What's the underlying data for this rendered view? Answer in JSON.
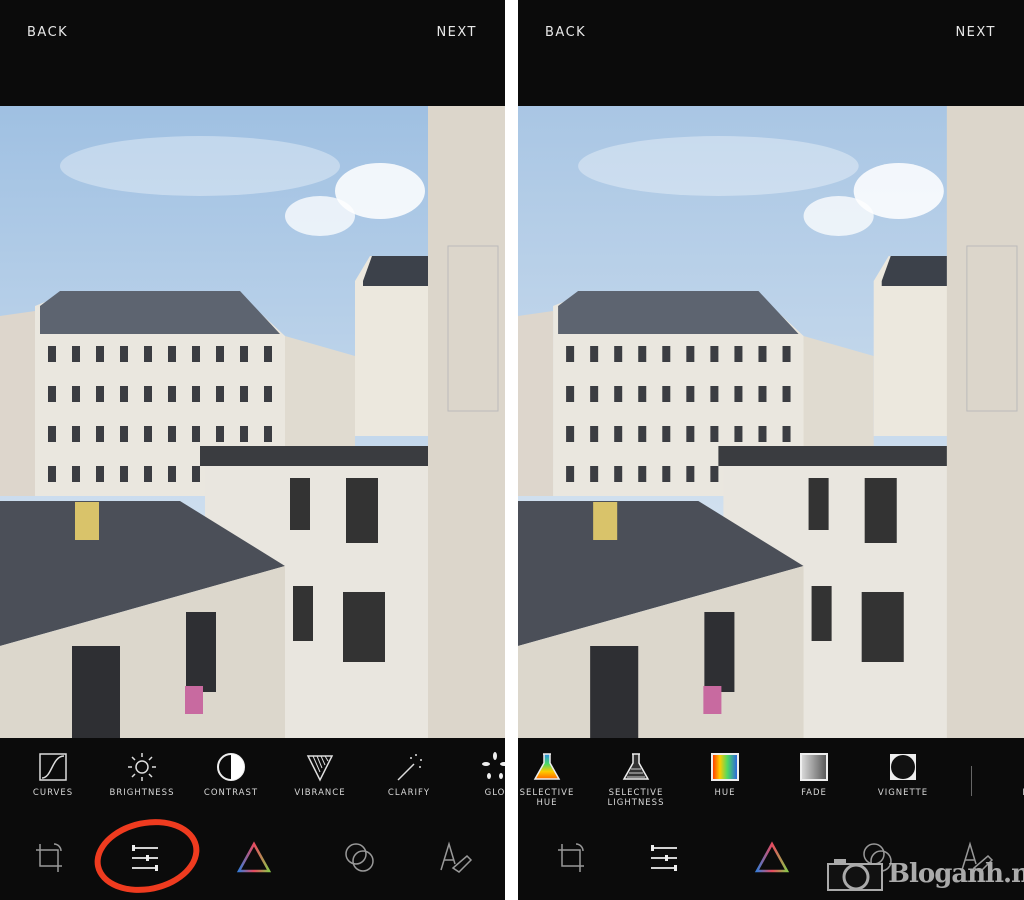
{
  "left": {
    "back_label": "BACK",
    "next_label": "NEXT",
    "tools": [
      {
        "label": "CURVES",
        "icon": "curves-icon"
      },
      {
        "label": "BRIGHTNESS",
        "icon": "sun-icon"
      },
      {
        "label": "CONTRAST",
        "icon": "contrast-icon"
      },
      {
        "label": "VIBRANCE",
        "icon": "vibrance-icon"
      },
      {
        "label": "CLARIFY",
        "icon": "magic-wand-icon"
      },
      {
        "label": "GLO",
        "icon": "glow-icon"
      }
    ],
    "nav": [
      "crop-rotate-icon",
      "sliders-icon",
      "prism-triangle-icon",
      "overlay-circles-icon",
      "text-pen-icon"
    ],
    "active_nav": "sliders-icon",
    "annotation_color": "#ef3b1f"
  },
  "right": {
    "back_label": "BACK",
    "next_label": "NEXT",
    "tools": [
      {
        "label": "SELECTIVE\nHUE",
        "icon": "color-flask-icon"
      },
      {
        "label": "SELECTIVE\nLIGHTNESS",
        "icon": "grey-flask-icon"
      },
      {
        "label": "HUE",
        "icon": "rainbow-square-icon"
      },
      {
        "label": "FADE",
        "icon": "fade-square-icon"
      },
      {
        "label": "VIGNETTE",
        "icon": "vignette-icon"
      },
      {
        "label": "EX",
        "icon": ""
      }
    ],
    "nav": [
      "crop-rotate-icon",
      "sliders-icon",
      "prism-triangle-icon",
      "overlay-circles-icon",
      "text-pen-icon"
    ]
  },
  "watermark": {
    "text": "Bloganh.net",
    "icon": "camera-icon"
  }
}
